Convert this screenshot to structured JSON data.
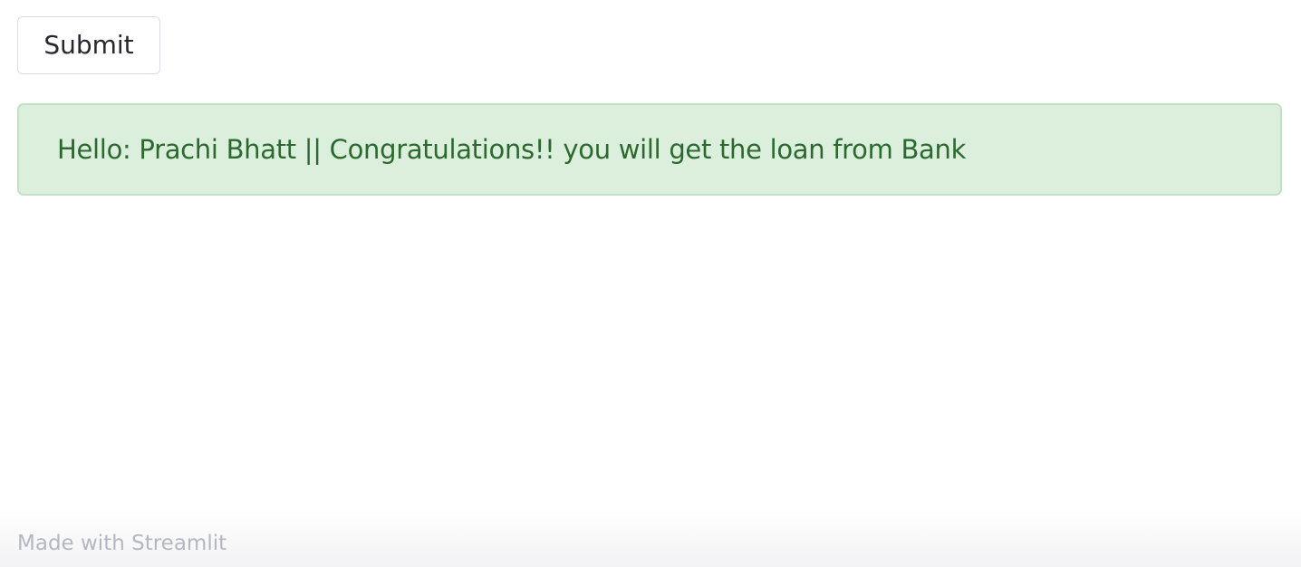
{
  "form": {
    "submit_label": "Submit"
  },
  "result": {
    "message": "Hello: Prachi Bhatt || Congratulations!! you will get the loan from Bank",
    "status_colors": {
      "background": "#dcefdc",
      "border": "#c2e2c4",
      "text": "#2b6a2f"
    }
  },
  "footer": {
    "text": "Made with Streamlit"
  }
}
